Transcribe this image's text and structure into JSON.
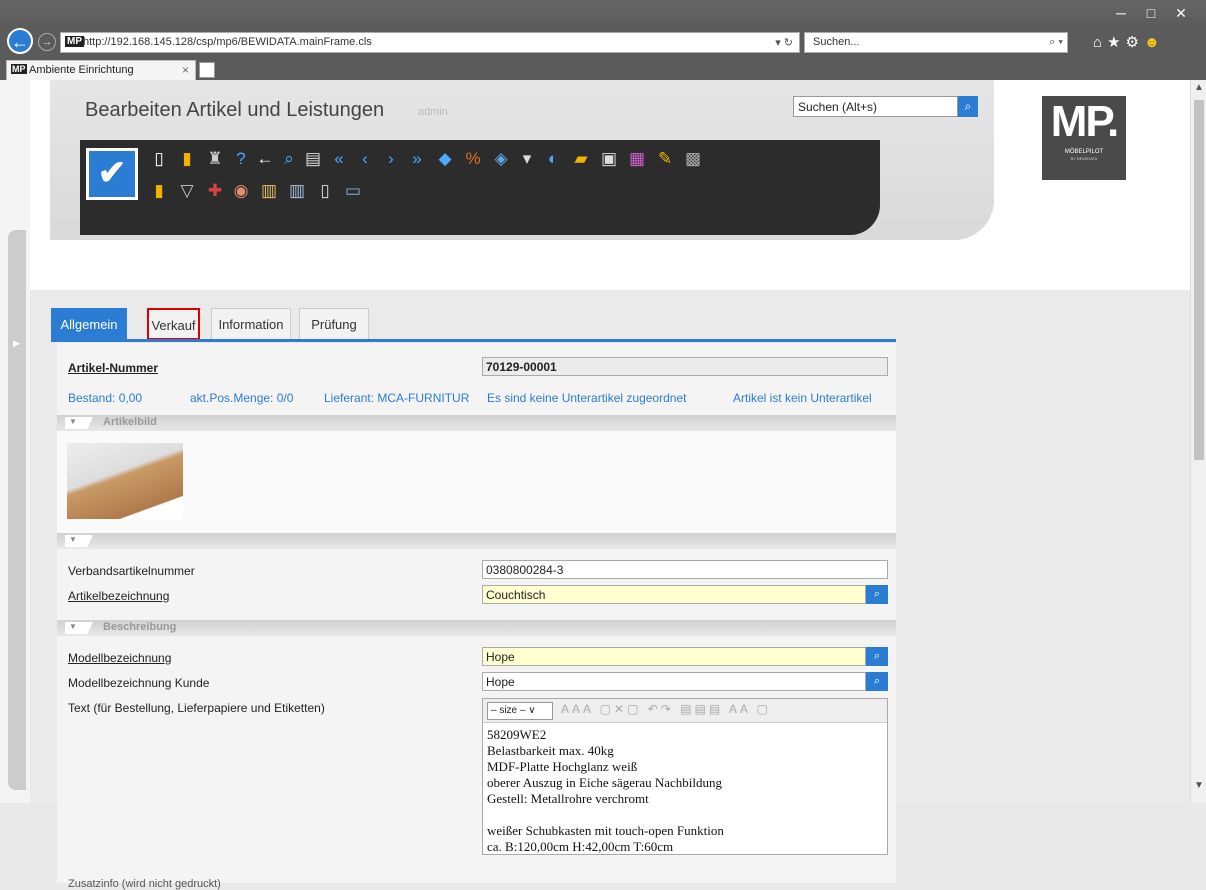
{
  "browser": {
    "url": "http://192.168.145.128/csp/mp6/BEWIDATA.mainFrame.cls",
    "url_logo": "MP",
    "refresh_ctl": "▾ ↻",
    "search_placeholder": "Suchen...",
    "search_ctl": "⌕ ▾",
    "tab_title": "Ambiente Einrichtung",
    "tab_logo": "MP",
    "tab_close": "×",
    "window_controls": [
      "─",
      "□",
      "✕"
    ],
    "icons": [
      "home-icon",
      "star-icon",
      "gear-icon",
      "smiley-icon"
    ]
  },
  "header": {
    "title": "Bearbeiten Artikel und Leistungen",
    "user": "admin",
    "search_placeholder": "Suchen (Alt+s)",
    "logo_text": "MP.",
    "logo_sub": "MÖBELPILOT",
    "logo_sub2": "BY BEWIDATA"
  },
  "tabs": [
    {
      "label": "Allgemein",
      "active": true
    },
    {
      "label": "Verkauf",
      "highlighted": true
    },
    {
      "label": "Information"
    },
    {
      "label": "Prüfung"
    }
  ],
  "form": {
    "artikel_nummer_label": "Artikel-Nummer",
    "artikel_nummer": "70129-00001",
    "bestand": "Bestand: 0,00",
    "pos_menge": "akt.Pos.Menge: 0/0",
    "lieferant": "Lieferant: MCA-FURNITUR",
    "unterartikel": "Es sind keine Unterartikel zugeordnet",
    "kein_unterartikel": "Artikel ist kein Unterartikel",
    "section_artikelbild": "Artikelbild",
    "verbands_label": "Verbandsartikelnummer",
    "verbands_value": "0380800284-3",
    "bezeichnung_label": "Artikelbezeichnung",
    "bezeichnung_value": "Couchtisch",
    "section_beschreibung": "Beschreibung",
    "modell_label": "Modellbezeichnung",
    "modell_value": "Hope",
    "modell_kunde_label": "Modellbezeichnung Kunde",
    "modell_kunde_value": "Hope",
    "text_label": "Text (für Bestellung, Lieferpapiere und Etiketten)",
    "size_select": "– size –",
    "text_lines": [
      "58209WE2",
      "Belastbarkeit max. 40kg",
      "MDF-Platte Hochglanz weiß",
      "oberer Auszug in Eiche sägerau Nachbildung",
      "Gestell: Metallrohre verchromt",
      "",
      "weißer Schubkasten mit touch-open Funktion",
      "ca. B:120,00cm H:42,00cm T:60cm"
    ],
    "cutoff_label": "Zusatzinfo (wird nicht gedruckt)"
  },
  "colors": {
    "accent": "#2b7cd3",
    "highlight": "#dd0000",
    "field_required": "#ffffd0"
  }
}
